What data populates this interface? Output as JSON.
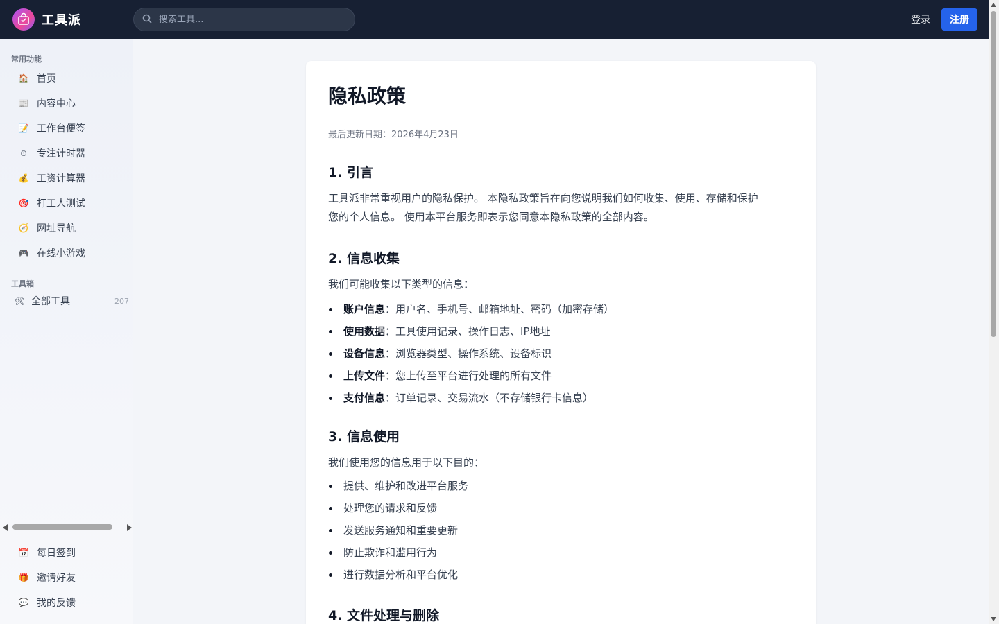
{
  "header": {
    "brand": "工具派",
    "search_placeholder": "搜索工具...",
    "login_label": "登录",
    "register_label": "注册"
  },
  "sidebar": {
    "common_title": "常用功能",
    "common_items": [
      {
        "icon": "house-icon",
        "label": "首页"
      },
      {
        "icon": "newspaper-icon",
        "label": "内容中心"
      },
      {
        "icon": "memo-icon",
        "label": "工作台便签"
      },
      {
        "icon": "stopwatch-icon",
        "label": "专注计时器"
      },
      {
        "icon": "money-bag-icon",
        "label": "工资计算器"
      },
      {
        "icon": "target-icon",
        "label": "打工人测试"
      },
      {
        "icon": "compass-icon",
        "label": "网址导航"
      },
      {
        "icon": "gamepad-icon",
        "label": "在线小游戏"
      }
    ],
    "toolbox_title": "工具箱",
    "toolbox_items": [
      {
        "icon": "hammer-wrench-icon",
        "label": "全部工具",
        "count": "207"
      }
    ],
    "bottom_items": [
      {
        "icon": "calendar-icon",
        "label": "每日签到"
      },
      {
        "icon": "gift-icon",
        "label": "邀请好友"
      },
      {
        "icon": "speech-bubble-icon",
        "label": "我的反馈"
      }
    ]
  },
  "article": {
    "title": "隐私政策",
    "updated": "最后更新日期：2026年4月23日",
    "s1_title": "1. 引言",
    "s1_line1": "工具派非常重视用户的隐私保护。 本隐私政策旨在向您说明我们如何收集、使用、存储和保护",
    "s1_line2": "您的个人信息。 使用本平台服务即表示您同意本隐私政策的全部内容。",
    "s2_title": "2. 信息收集",
    "s2_intro": "我们可能收集以下类型的信息：",
    "s2_items": [
      {
        "term": "账户信息",
        "desc": "：用户名、手机号、邮箱地址、密码（加密存储）"
      },
      {
        "term": "使用数据",
        "desc": "：工具使用记录、操作日志、IP地址"
      },
      {
        "term": "设备信息",
        "desc": "：浏览器类型、操作系统、设备标识"
      },
      {
        "term": "上传文件",
        "desc": "：您上传至平台进行处理的所有文件"
      },
      {
        "term": "支付信息",
        "desc": "：订单记录、交易流水（不存储银行卡信息）"
      }
    ],
    "s3_title": "3. 信息使用",
    "s3_intro": "我们使用您的信息用于以下目的：",
    "s3_items": [
      "提供、维护和改进平台服务",
      "处理您的请求和反馈",
      "发送服务通知和重要更新",
      "防止欺诈和滥用行为",
      "进行数据分析和平台优化"
    ],
    "s4_title": "4. 文件处理与删除"
  }
}
